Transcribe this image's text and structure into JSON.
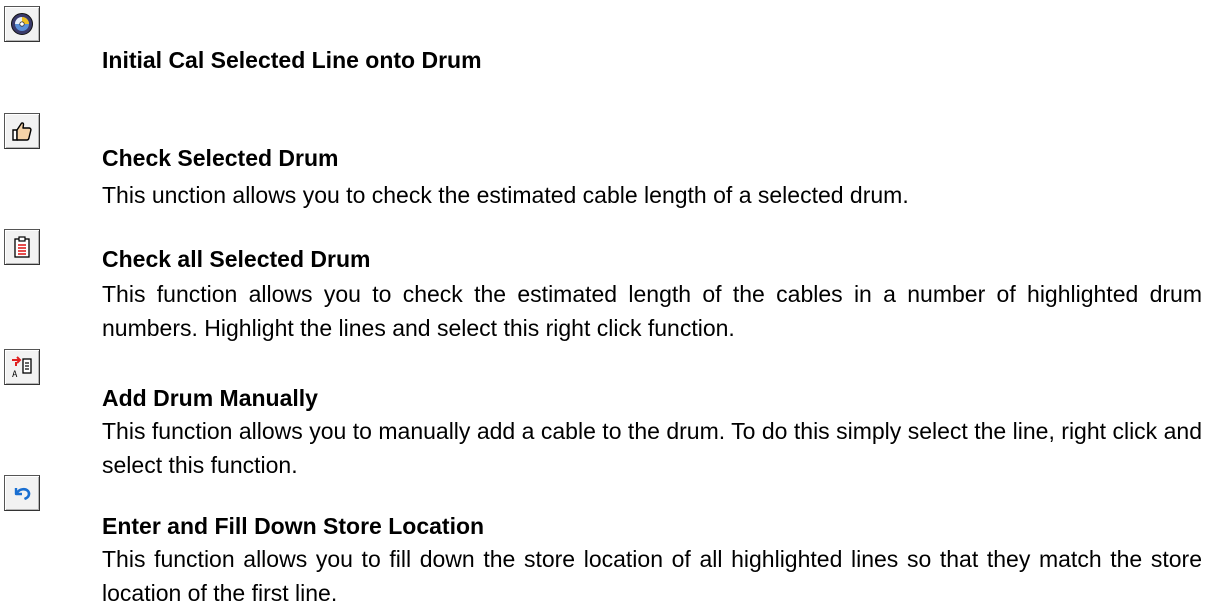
{
  "items": [
    {
      "icon": "cd-disc-icon",
      "title": "Initial Cal Selected Line onto Drum",
      "description": ""
    },
    {
      "icon": "thumbs-up-icon",
      "title": "Check Selected Drum",
      "description": "This unction allows you to check the estimated cable length of a selected drum."
    },
    {
      "icon": "document-list-icon",
      "title": "Check all Selected Drum",
      "description": "This function allows you to check the estimated length of the cables in a number of highlighted drum numbers. Highlight the lines and select this right click function."
    },
    {
      "icon": "add-arrow-icon",
      "title": "Add Drum Manually",
      "description": "This function allows you to manually add a cable to the drum. To do this simply select the line, right click and select this function."
    },
    {
      "icon": "undo-arrow-icon",
      "title": "Enter and Fill Down Store Location",
      "description": "This function allows you to fill down the store location of all highlighted lines so that they match the store location of the first line."
    }
  ],
  "colors": {
    "text": "#000000",
    "icon_border": "#555555",
    "icon_bg": "#f2f2f2",
    "accent_red": "#e02020",
    "accent_blue": "#1a6fd1"
  }
}
